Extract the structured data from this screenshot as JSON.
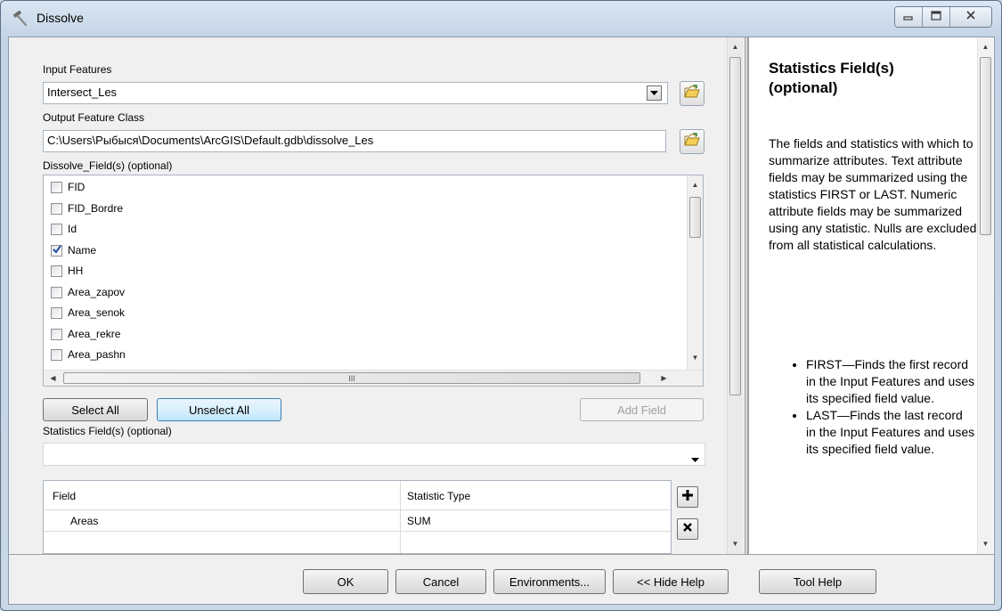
{
  "window": {
    "title": "Dissolve",
    "icon": "hammer-icon",
    "controls": [
      "minimize-icon",
      "maximize-icon",
      "close-icon"
    ]
  },
  "input_features": {
    "label": "Input Features",
    "value": "Intersect_Les"
  },
  "output_feature_class": {
    "label": "Output Feature Class",
    "value": "C:\\Users\\Рыбыся\\Documents\\ArcGIS\\Default.gdb\\dissolve_Les"
  },
  "dissolve_fields": {
    "label": "Dissolve_Field(s) (optional)",
    "items": [
      {
        "label": "FID",
        "checked": false
      },
      {
        "label": "FID_Bordre",
        "checked": false
      },
      {
        "label": "Id",
        "checked": false
      },
      {
        "label": "Name",
        "checked": true
      },
      {
        "label": "HH",
        "checked": false
      },
      {
        "label": "Area_zapov",
        "checked": false
      },
      {
        "label": "Area_senok",
        "checked": false
      },
      {
        "label": "Area_rekre",
        "checked": false
      },
      {
        "label": "Area_pashn",
        "checked": false
      }
    ],
    "hscroll_grip": "III"
  },
  "list_buttons": {
    "select_all": "Select All",
    "unselect_all": "Unselect All",
    "add_field": "Add Field"
  },
  "statistics": {
    "label": "Statistics Field(s) (optional)",
    "combo_value": "",
    "columns": [
      "Field",
      "Statistic Type"
    ],
    "rows": [
      {
        "field": "Areas",
        "statistic": "SUM"
      }
    ]
  },
  "footer": {
    "ok": "OK",
    "cancel": "Cancel",
    "environments": "Environments...",
    "hide_help": "<< Hide Help",
    "tool_help": "Tool Help"
  },
  "help": {
    "title": "Statistics Field(s) (optional)",
    "body": "The fields and statistics with which to summarize attributes. Text attribute fields may be summarized using the statistics FIRST or LAST. Numeric attribute fields may be summarized using any statistic. Nulls are excluded from all statistical calculations.",
    "bullets": [
      "FIRST—Finds the first record in the Input Features and uses its specified field value.",
      "LAST—Finds the last record in the Input Features and uses its specified field value."
    ]
  }
}
